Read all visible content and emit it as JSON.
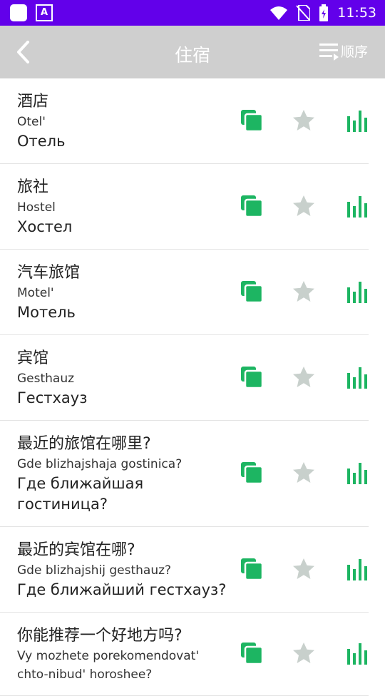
{
  "status_bar": {
    "time": "11:53"
  },
  "header": {
    "title": "住宿",
    "sort_label": "顺序"
  },
  "colors": {
    "accent": "#1db562",
    "star": "#c8d0cc",
    "status_bar": "#6200ea",
    "app_bar": "#cfcfcf"
  },
  "phrases": [
    {
      "cn": "酒店",
      "translit": "Otel'",
      "ru": "Отель"
    },
    {
      "cn": "旅社",
      "translit": "Hostel",
      "ru": "Хостел"
    },
    {
      "cn": "汽车旅馆",
      "translit": "Motel'",
      "ru": "Мотель"
    },
    {
      "cn": "宾馆",
      "translit": "Gesthauz",
      "ru": "Гестхауз"
    },
    {
      "cn": "最近的旅馆在哪里?",
      "translit": "Gde blizhajshaja gostinica?",
      "ru": "Где ближайшая гостиница?"
    },
    {
      "cn": "最近的宾馆在哪?",
      "translit": "Gde blizhajshij gesthauz?",
      "ru": "Где ближайший гестхауз?"
    },
    {
      "cn": "你能推荐一个好地方吗?",
      "translit": "Vy mozhete porekomendovat' chto-nibud' horoshee?",
      "ru": ""
    }
  ]
}
